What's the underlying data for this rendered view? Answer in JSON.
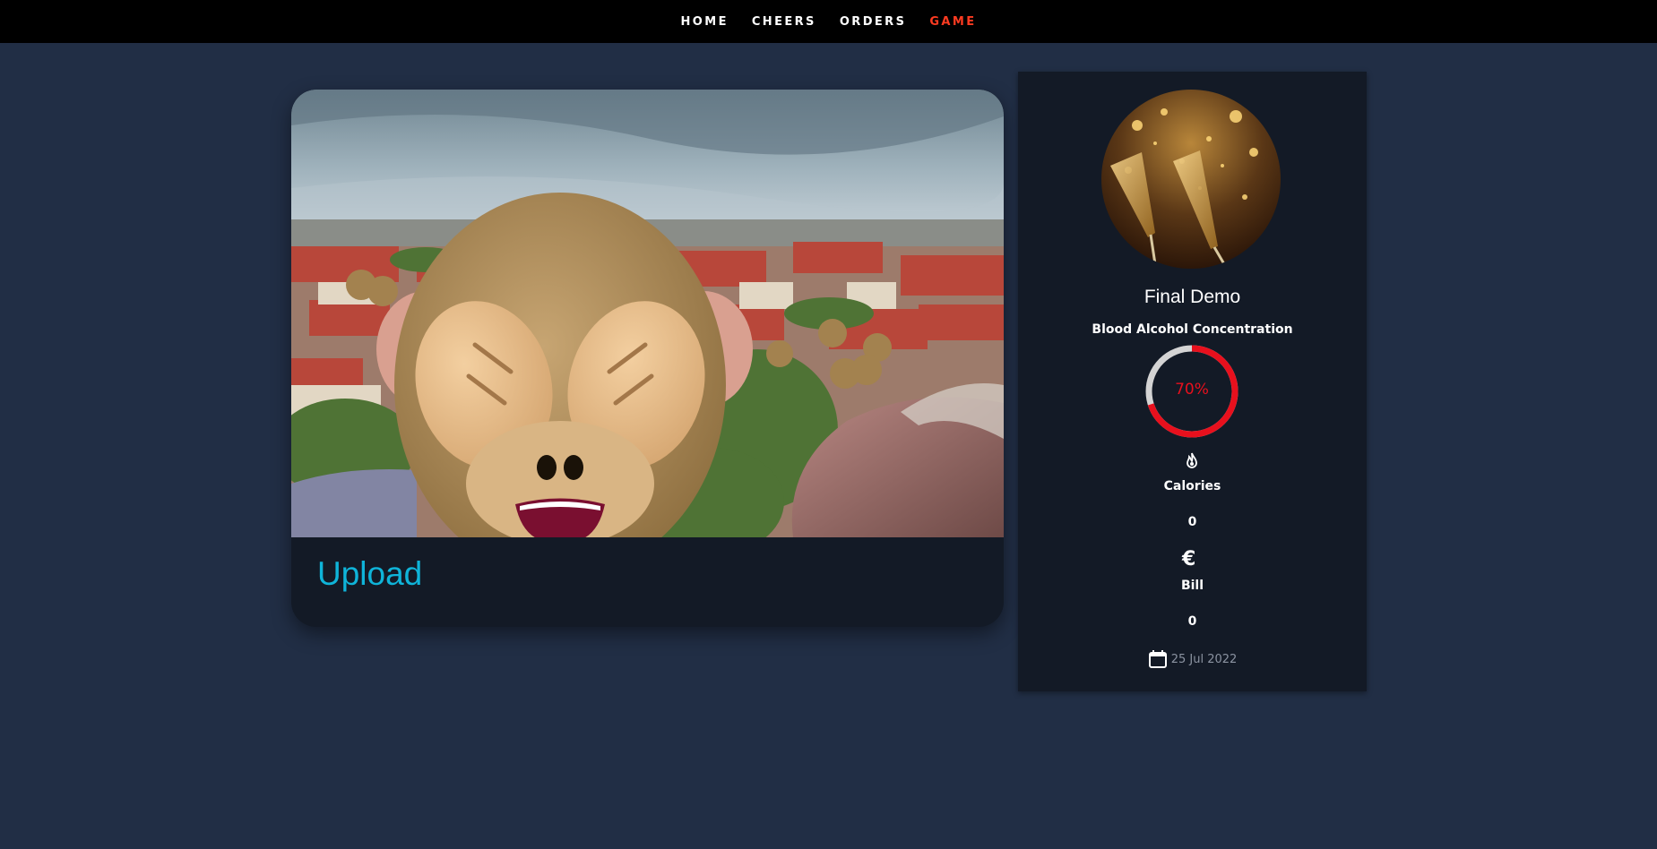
{
  "nav": {
    "items": [
      {
        "label": "HOME",
        "active": false
      },
      {
        "label": "CHEERS",
        "active": false
      },
      {
        "label": "ORDERS",
        "active": false
      },
      {
        "label": "GAME",
        "active": true
      }
    ],
    "active_color": "#ff3b21"
  },
  "media_card": {
    "image_description_icon": "see-no-evil-monkey-filter",
    "upload_label": "Upload",
    "link_color": "#0fb4d9"
  },
  "profile": {
    "avatar_icon": "champagne-glasses-photo",
    "name": "Final Demo",
    "bac_label": "Blood Alcohol Concentration",
    "bac_percent": 70,
    "bac_text": "70%",
    "bac_color": "#e8101d",
    "calories_icon": "fire-icon",
    "calories_label": "Calories",
    "calories_value": "0",
    "bill_icon": "euro-icon",
    "bill_label": "Bill",
    "bill_value": "0",
    "date_icon": "calendar-icon",
    "date": "25 Jul 2022"
  },
  "colors": {
    "background": "#212e45",
    "panel": "#131a26",
    "navbar": "#000000"
  }
}
